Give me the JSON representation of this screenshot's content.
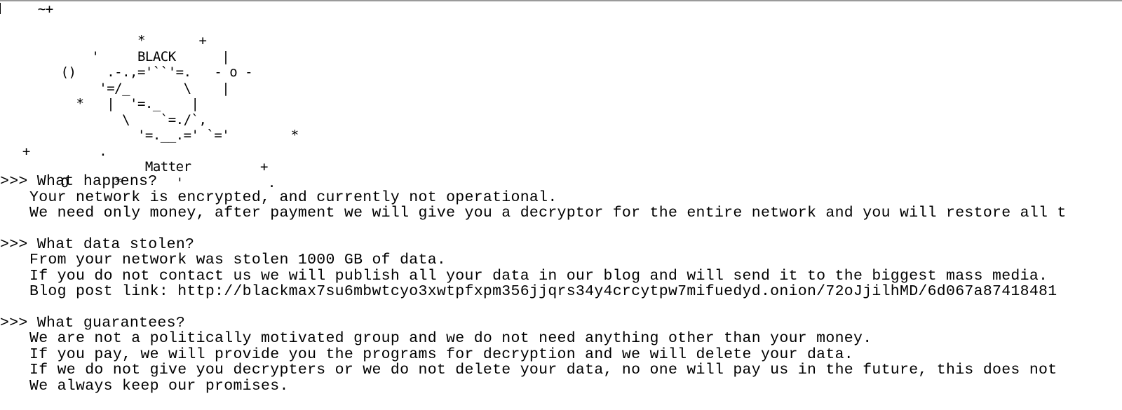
{
  "window": {
    "title": ""
  },
  "ascii_art": {
    "lines": [
      "    ~+",
      "",
      "                 *       +",
      "           '     BLACK      |",
      "       ()    .-.,='``'=.   - o -",
      "            '=/_       \\    |",
      "         *   |  '=._    |",
      "               \\    `=./`,",
      "                 '=.__.=' `='        *",
      "  +         .",
      "                  Matter         +",
      "       O      *       '           ."
    ],
    "logo_words": [
      "BLACK",
      "Matter"
    ]
  },
  "note": {
    "sections": [
      {
        "heading": ">>> What happens?",
        "lines": [
          "Your network is encrypted, and currently not operational.",
          "We need only money, after payment we will give you a decryptor for the entire network and you will restore all t"
        ]
      },
      {
        "heading": ">>> What data stolen?",
        "lines": [
          "From your network was stolen 1000 GB of data.",
          "If you do not contact us we will publish all your data in our blog and will send it to the biggest mass media.",
          "Blog post link: http://blackmax7su6mbwtcyo3xwtpfxpm356jjqrs34y4crcytpw7mifuedyd.onion/72oJjilhMD/6d067a87418481"
        ]
      },
      {
        "heading": ">>> What guarantees?",
        "lines": [
          "We are not a politically motivated group and we do not need anything other than your money.",
          "If you pay, we will provide you the programs for decryption and we will delete your data.",
          "If we do not give you decrypters or we do not delete your data, no one will pay us in the future, this does not",
          "We always keep our promises."
        ]
      }
    ]
  }
}
